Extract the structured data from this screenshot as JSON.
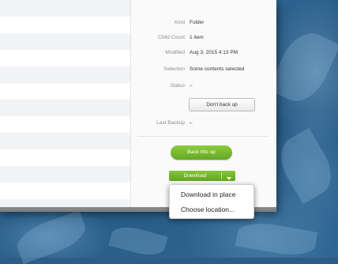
{
  "info": {
    "kind_label": "Kind",
    "kind_value": "Folder",
    "child_count_label": "Child Count",
    "child_count_value": "1 item",
    "modified_label": "Modified",
    "modified_value": "Aug 3, 2015 4:13 PM",
    "selection_label": "Selection",
    "selection_value": "Some contents selected",
    "status_label": "Status",
    "status_value": "–",
    "last_backup_label": "Last Backup",
    "last_backup_value": "–"
  },
  "buttons": {
    "dont_back_up": "Don't back up",
    "back_this_up": "Back this up",
    "download": "Download"
  },
  "download_menu": {
    "items": [
      "Download in place",
      "Choose location..."
    ]
  },
  "colors": {
    "accent_green": "#6fb22b",
    "wallpaper_blue": "#2c5d86"
  }
}
